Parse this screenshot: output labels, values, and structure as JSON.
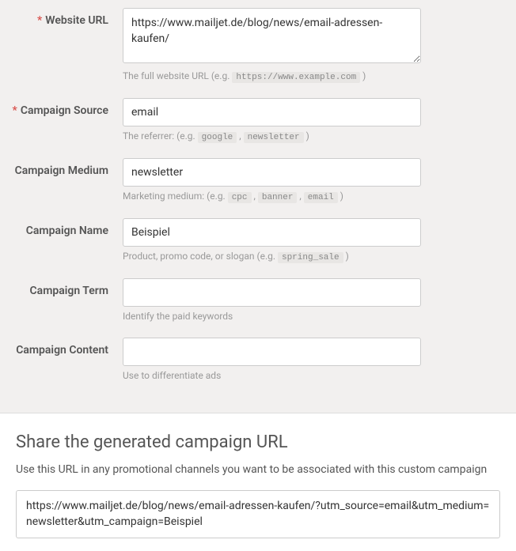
{
  "fields": {
    "website_url": {
      "label": "Website URL",
      "value": "https://www.mailjet.de/blog/news/email-adressen-kaufen/",
      "help_prefix": "The full website URL (e.g. ",
      "help_code": "https://www.example.com",
      "help_suffix": " )"
    },
    "campaign_source": {
      "label": "Campaign Source",
      "value": "email",
      "help_prefix": "The referrer: (e.g. ",
      "help_code1": "google",
      "help_sep1": " , ",
      "help_code2": "newsletter",
      "help_suffix": " )"
    },
    "campaign_medium": {
      "label": "Campaign Medium",
      "value": "newsletter",
      "help_prefix": "Marketing medium: (e.g. ",
      "help_code1": "cpc",
      "help_sep1": " , ",
      "help_code2": "banner",
      "help_sep2": " , ",
      "help_code3": "email",
      "help_suffix": " )"
    },
    "campaign_name": {
      "label": "Campaign Name",
      "value": "Beispiel",
      "help_prefix": "Product, promo code, or slogan (e.g. ",
      "help_code": "spring_sale",
      "help_suffix": " )"
    },
    "campaign_term": {
      "label": "Campaign Term",
      "value": "",
      "help": "Identify the paid keywords"
    },
    "campaign_content": {
      "label": "Campaign Content",
      "value": "",
      "help": "Use to differentiate ads"
    }
  },
  "share": {
    "title": "Share the generated campaign URL",
    "desc": "Use this URL in any promotional channels you want to be associated with this custom campaign",
    "url": "https://www.mailjet.de/blog/news/email-adressen-kaufen/?utm_source=email&utm_medium=newsletter&utm_campaign=Beispiel"
  }
}
